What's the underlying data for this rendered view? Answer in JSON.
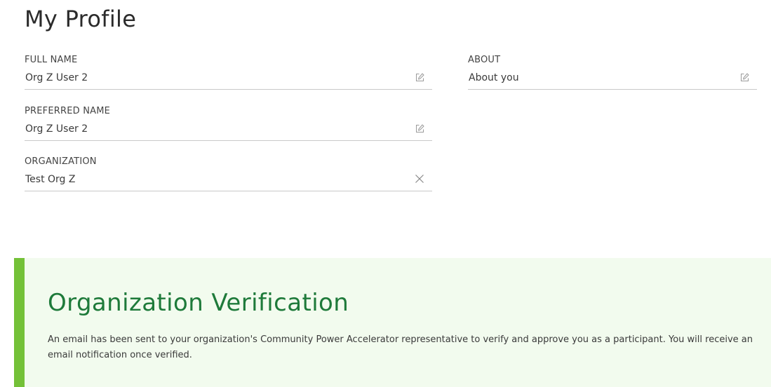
{
  "profile": {
    "title": "My Profile",
    "full_name": {
      "label": "FULL NAME",
      "value": "Org Z User 2",
      "icon": "edit-icon"
    },
    "preferred_name": {
      "label": "PREFERRED NAME",
      "value": "Org Z User 2",
      "icon": "edit-icon"
    },
    "organization": {
      "label": "ORGANIZATION",
      "value": "Test Org Z",
      "icon": "close-icon"
    },
    "about": {
      "label": "ABOUT",
      "value": "About you",
      "icon": "edit-icon"
    }
  },
  "verification": {
    "title": "Organization Verification",
    "message": "An email has been sent to your organization's Community Power Accelerator representative to verify and approve you as a participant. You will receive an email notification once verified."
  },
  "colors": {
    "accent_bar": "#74c138",
    "panel_background": "#f2fbee",
    "verification_title": "#1e7a3a",
    "field_border": "#c9c9c9"
  }
}
